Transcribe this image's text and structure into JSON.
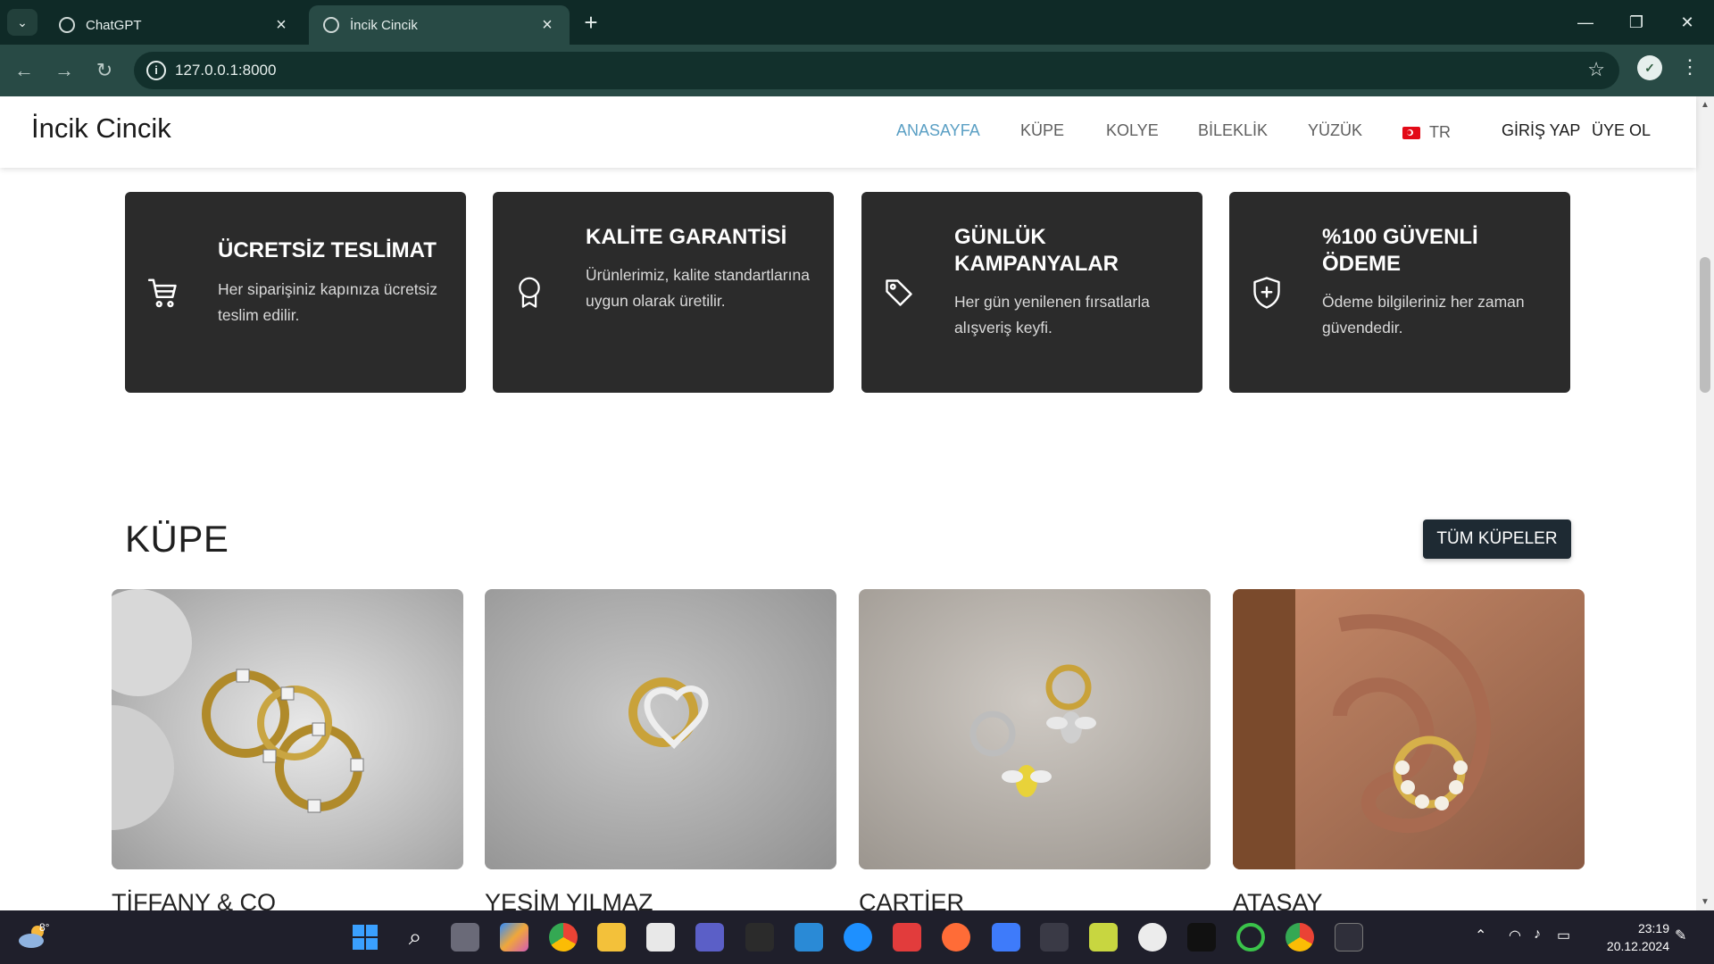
{
  "browser": {
    "tabs": [
      {
        "title": "ChatGPT",
        "active": false
      },
      {
        "title": "İncik Cincik",
        "active": true
      }
    ],
    "url": "127.0.0.1:8000"
  },
  "site": {
    "brand": "İncik Cincik",
    "nav": [
      {
        "label": "ANASAYFA",
        "active": true
      },
      {
        "label": "KÜPE"
      },
      {
        "label": "KOLYE"
      },
      {
        "label": "BİLEKLİK"
      },
      {
        "label": "YÜZÜK"
      }
    ],
    "language": "TR",
    "login": "GİRİŞ YAP",
    "register": "ÜYE OL"
  },
  "features": [
    {
      "icon": "cart-icon",
      "title": "ÜCRETSİZ TESLİMAT",
      "text": "Her siparişiniz kapınıza ücretsiz teslim edilir."
    },
    {
      "icon": "award-icon",
      "title": "KALİTE GARANTİSİ",
      "text": "Ürünlerimiz, kalite standartlarına uygun olarak üretilir."
    },
    {
      "icon": "tag-icon",
      "title": "GÜNLÜK KAMPANYALAR",
      "text": "Her gün yenilenen fırsatlarla alışveriş keyfi."
    },
    {
      "icon": "shield-plus-icon",
      "title": "%100 GÜVENLİ ÖDEME",
      "text": "Ödeme bilgileriniz her zaman güvendedir."
    }
  ],
  "section": {
    "title": "KÜPE",
    "all_button": "TÜM KÜPELER"
  },
  "products": [
    {
      "name": "TİFFANY & CO"
    },
    {
      "name": "YEŞİM YILMAZ"
    },
    {
      "name": "CARTİER"
    },
    {
      "name": "ATASAY"
    }
  ],
  "taskbar": {
    "weather_temp": "8°",
    "time": "23:19",
    "date": "20.12.2024"
  }
}
